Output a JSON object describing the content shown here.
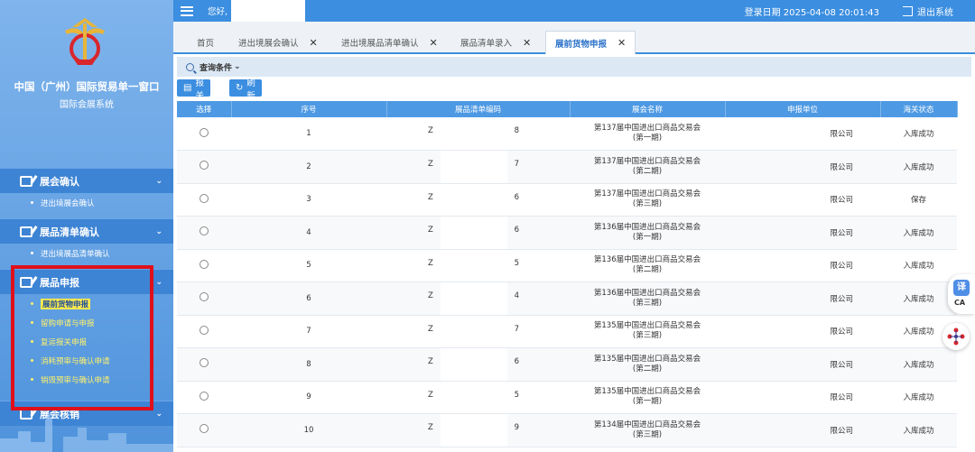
{
  "sidebar": {
    "title": "中国（广州）国际贸易单一窗口",
    "subtitle": "国际会展系统",
    "groups": [
      {
        "label": "展会确认",
        "items": [
          {
            "label": "进出境展会确认"
          }
        ]
      },
      {
        "label": "展品清单确认",
        "items": [
          {
            "label": "进出境展品清单确认"
          }
        ]
      },
      {
        "label": "展品申报",
        "items": [
          {
            "label": "展前货物申报"
          },
          {
            "label": "留购申请与申报"
          },
          {
            "label": "复运报关申报"
          },
          {
            "label": "消耗预审与确认申请"
          },
          {
            "label": "销毁预审与确认申请"
          }
        ]
      },
      {
        "label": "展会核销"
      }
    ]
  },
  "header": {
    "greeting": "您好,",
    "login_date": "登录日期 2025-04-08 20:01:43",
    "logout": "退出系统"
  },
  "tabs": [
    {
      "label": "首页"
    },
    {
      "label": "进出境展会确认"
    },
    {
      "label": "进出境展品清单确认"
    },
    {
      "label": "展品清单录入"
    },
    {
      "label": "展前货物申报"
    }
  ],
  "query": {
    "label": "查询条件"
  },
  "buttons": {
    "declare": "报关",
    "refresh": "刷 新"
  },
  "table": {
    "columns": [
      "选择",
      "序号",
      "展品清单编码",
      "展会名称",
      "申报单位",
      "海关状态"
    ],
    "rows": [
      {
        "no": "1",
        "code_l": "Z",
        "code_r": "8",
        "expo_1": "第137届中国进出口商品交易会",
        "expo_2": "(第一期)",
        "unit": "限公司",
        "status": "入库成功"
      },
      {
        "no": "2",
        "code_l": "Z",
        "code_r": "7",
        "expo_1": "第137届中国进出口商品交易会",
        "expo_2": "(第二期)",
        "unit": "限公司",
        "status": "入库成功"
      },
      {
        "no": "3",
        "code_l": "Z",
        "code_r": "6",
        "expo_1": "第137届中国进出口商品交易会",
        "expo_2": "(第三期)",
        "unit": "限公司",
        "status": "保存"
      },
      {
        "no": "4",
        "code_l": "Z",
        "code_r": "6",
        "expo_1": "第136届中国进出口商品交易会",
        "expo_2": "(第一期)",
        "unit": "限公司",
        "status": "入库成功"
      },
      {
        "no": "5",
        "code_l": "Z",
        "code_r": "5",
        "expo_1": "第136届中国进出口商品交易会",
        "expo_2": "(第二期)",
        "unit": "限公司",
        "status": "入库成功"
      },
      {
        "no": "6",
        "code_l": "Z",
        "code_r": "4",
        "expo_1": "第136届中国进出口商品交易会",
        "expo_2": "(第三期)",
        "unit": "限公司",
        "status": "入库成功"
      },
      {
        "no": "7",
        "code_l": "Z",
        "code_r": "7",
        "expo_1": "第135届中国进出口商品交易会",
        "expo_2": "(第三期)",
        "unit": "限公司",
        "status": "入库成功"
      },
      {
        "no": "8",
        "code_l": "Z",
        "code_r": "6",
        "expo_1": "第135届中国进出口商品交易会",
        "expo_2": "(第二期)",
        "unit": "限公司",
        "status": "入库成功"
      },
      {
        "no": "9",
        "code_l": "Z",
        "code_r": "5",
        "expo_1": "第135届中国进出口商品交易会",
        "expo_2": "(第一期)",
        "unit": "限公司",
        "status": "入库成功"
      },
      {
        "no": "10",
        "code_l": "Z",
        "code_r": "9",
        "expo_1": "第134届中国进出口商品交易会",
        "expo_2": "(第三期)",
        "unit": "限公司",
        "status": "入库成功"
      }
    ]
  },
  "floating": {
    "translate_glyph": "译",
    "translate_label": "CA"
  },
  "colors": {
    "primary": "#3b8ee0",
    "sidebar": "#4f93dc",
    "highlight": "#e0101a",
    "active_item": "#ffe94d"
  }
}
